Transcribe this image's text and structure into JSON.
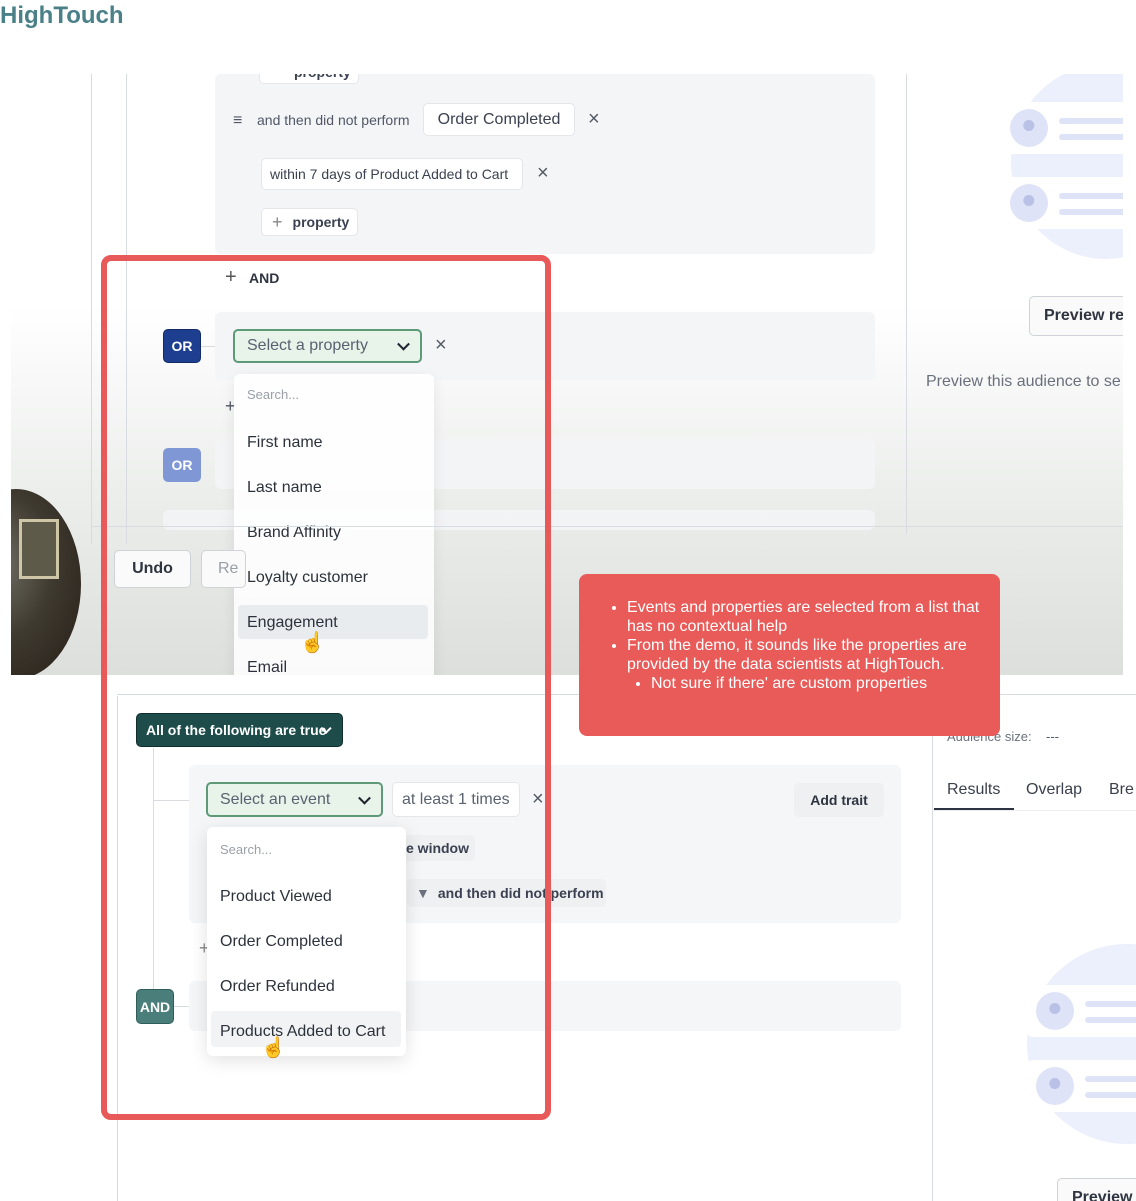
{
  "brand": "HighTouch",
  "top": {
    "property_chip": "property",
    "did_not_perform_label": "and then did not perform",
    "order_completed_chip": "Order Completed",
    "within_chip": "within 7 days of Product Added to Cart",
    "add_property": "property",
    "and_label": "AND",
    "or_badge": "OR",
    "or_badge_2": "OR",
    "select_property": "Select a property",
    "search_placeholder": "Search...",
    "properties": [
      "First name",
      "Last name",
      "Brand Affinity",
      "Loyalty customer",
      "Engagement",
      "Email"
    ],
    "undo_button": "Undo",
    "redo_button": "Re",
    "preview_button": "Preview re",
    "preview_text": "Preview this audience to se"
  },
  "bottom": {
    "all_true": "All of the following are true",
    "select_event": "Select an event",
    "at_least": "at least 1 times",
    "add_trait": "Add trait",
    "window_chip": "e window",
    "did_not_perform": "and then did not perform",
    "search_placeholder": "Search...",
    "events": [
      "Product Viewed",
      "Order Completed",
      "Order Refunded",
      "Products Added to Cart"
    ],
    "and_badge": "AND",
    "audience_size": "Audience size:",
    "audience_value": "---",
    "tabs": [
      "Results",
      "Overlap",
      "Bre"
    ],
    "preview_button": "Preview"
  },
  "note": {
    "bullets": [
      "Events and properties are selected from a list that has no contextual help",
      "From the demo, it sounds like the properties are provided by the data scientists at HighTouch."
    ],
    "sub_bullet": "Not sure if there' are custom properties"
  },
  "colors": {
    "brand": "#4a8088",
    "highlight": "#e85a5a",
    "note_bg": "#e85b59",
    "or_badge": "#1e3f8f",
    "and_badge": "#4a7e7a",
    "all_true_bg": "#1d4c4a"
  }
}
